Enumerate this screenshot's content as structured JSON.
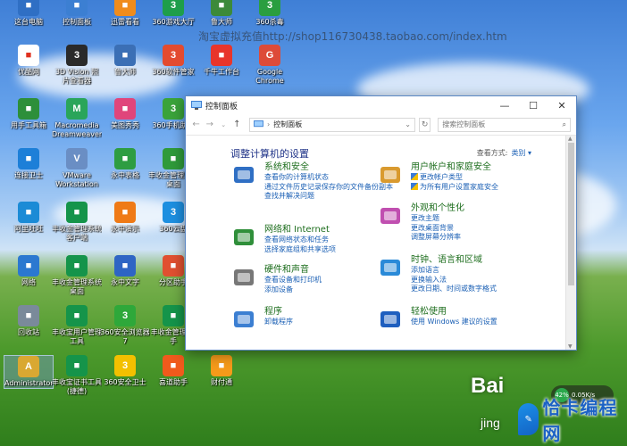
{
  "watermark": "淘宝虚拟充值http://shop116730438.taobao.com/index.htm",
  "desktop_icons": [
    {
      "label": "这台电脑",
      "icon": "computer-icon",
      "color": "#2f6fc4"
    },
    {
      "label": "控制面板",
      "icon": "control-panel-icon",
      "color": "#3c7fd2"
    },
    {
      "label": "迅雷看看",
      "icon": "xunlei-icon",
      "color": "#f08c1c"
    },
    {
      "label": "360游戏大厅",
      "icon": "game-icon",
      "color": "#1e9e4a"
    },
    {
      "label": "鲁大师",
      "icon": "ludashi-icon",
      "color": "#3c8a3a"
    },
    {
      "label": "360杀毒",
      "icon": "antivirus-icon",
      "color": "#2a9e40"
    },
    {
      "label": "优酷网",
      "icon": "youku-icon",
      "color": "#ffffff"
    },
    {
      "label": "3D Vision 照片查看器",
      "icon": "nvidia-icon",
      "color": "#2a2a2a"
    },
    {
      "label": "鲁大师",
      "icon": "ludashi-icon",
      "color": "#3b6fb5"
    },
    {
      "label": "360软件管家",
      "icon": "software-manager-icon",
      "color": "#e34b2f"
    },
    {
      "label": "千牛工作台",
      "icon": "qianniu-icon",
      "color": "#e8352b"
    },
    {
      "label": "Google Chrome",
      "icon": "chrome-icon",
      "color": "#dd4b39"
    },
    {
      "label": "用手工具箱",
      "icon": "toolbox-icon",
      "color": "#2d8f3a"
    },
    {
      "label": "Macromedia Dreamweaver",
      "icon": "dreamweaver-icon",
      "color": "#2aa55a"
    },
    {
      "label": "美图秀秀",
      "icon": "meitu-icon",
      "color": "#e0457b"
    },
    {
      "label": "360手机助手",
      "icon": "phone-assistant-icon",
      "color": "#3aa33a"
    },
    {
      "label": "连接卫士",
      "icon": "wifi-icon",
      "color": "#1d7fd8"
    },
    {
      "label": "VMware Workstation",
      "icon": "vmware-icon",
      "color": "#6a8ec4"
    },
    {
      "label": "永中表格",
      "icon": "excel-icon",
      "color": "#2e9d42"
    },
    {
      "label": "丰收金管理系统桌面",
      "icon": "app-icon",
      "color": "#2f9a3a"
    },
    {
      "label": "阿里旺旺",
      "icon": "cloud-icon",
      "color": "#1b8bd6"
    },
    {
      "label": "丰收金管理系统 客户端",
      "icon": "app-icon",
      "color": "#15944a"
    },
    {
      "label": "永中演示",
      "icon": "ppt-icon",
      "color": "#ef7a16"
    },
    {
      "label": "360云盘",
      "icon": "cloud-icon",
      "color": "#1d8fe0"
    },
    {
      "label": "网络",
      "icon": "network-icon",
      "color": "#2b78d0"
    },
    {
      "label": "丰收金管理系统桌面",
      "icon": "app-icon",
      "color": "#15944a"
    },
    {
      "label": "永中文字",
      "icon": "word-icon",
      "color": "#2e65c4"
    },
    {
      "label": "分区助手",
      "icon": "partition-icon",
      "color": "#e05030"
    },
    {
      "label": "回收站",
      "icon": "recycle-bin-icon",
      "color": "#7a8a9a"
    },
    {
      "label": "丰收宝用户管理工具",
      "icon": "app-icon",
      "color": "#15944a"
    },
    {
      "label": "360安全浏览器7",
      "icon": "browser-icon",
      "color": "#2ea83a"
    },
    {
      "label": "丰收金管理 助手",
      "icon": "app-icon",
      "color": "#15944a"
    },
    {
      "label": "Administrator",
      "icon": "user-folder-icon",
      "color": "#d9a832"
    },
    {
      "label": "丰收宝证书工具(捷德)",
      "icon": "app-icon",
      "color": "#15944a"
    },
    {
      "label": "360安全卫士",
      "icon": "shield-icon",
      "color": "#f3c000"
    },
    {
      "label": "喜道助手",
      "icon": "helper-icon",
      "color": "#f05a1c"
    },
    {
      "label": "财付通",
      "icon": "tenpay-icon",
      "color": "#f59a1a"
    }
  ],
  "window": {
    "title": "控制面板",
    "address": "控制面板",
    "search_placeholder": "搜索控制面板",
    "heading": "调整计算机的设置",
    "view_by_label": "查看方式:",
    "view_by_value": "类别"
  },
  "categories": [
    {
      "title": "系统和安全",
      "icon": "system-security-icon",
      "links": [
        "查看你的计算机状态",
        "通过文件历史记录保存你的文件备份副本",
        "查找并解决问题"
      ]
    },
    {
      "title": "网络和 Internet",
      "icon": "network-internet-icon",
      "links": [
        "查看网络状态和任务",
        "选择家庭组和共享选项"
      ]
    },
    {
      "title": "硬件和声音",
      "icon": "hardware-sound-icon",
      "links": [
        "查看设备和打印机",
        "添加设备"
      ]
    },
    {
      "title": "程序",
      "icon": "programs-icon",
      "links": [
        "卸载程序"
      ]
    },
    {
      "title": "用户帐户和家庭安全",
      "icon": "user-accounts-icon",
      "links": [
        "更改帐户类型",
        "为所有用户设置家庭安全"
      ]
    },
    {
      "title": "外观和个性化",
      "icon": "appearance-icon",
      "links": [
        "更改主题",
        "更改桌面背景",
        "调整屏幕分辨率"
      ]
    },
    {
      "title": "时钟、语言和区域",
      "icon": "clock-language-icon",
      "links": [
        "添加语言",
        "更换输入法",
        "更改日期、时间或数字格式"
      ]
    },
    {
      "title": "轻松使用",
      "icon": "ease-of-access-icon",
      "links": [
        "使用 Windows 建议的设置"
      ]
    }
  ],
  "overlays": {
    "baidu_logo": "Bai",
    "baidu_sub": "jing",
    "network_speed": "0.05K/s",
    "network_pct": "42%",
    "brand_text": "恰卡编程网"
  }
}
